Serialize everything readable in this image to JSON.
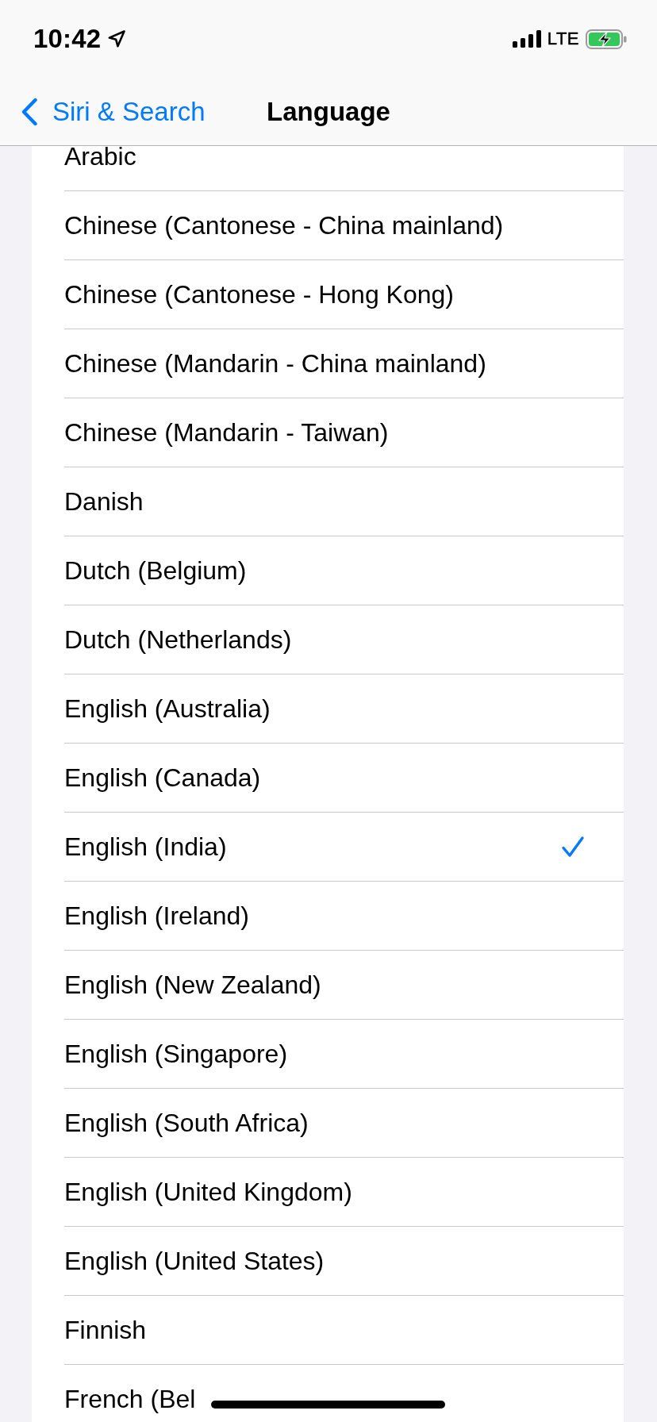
{
  "status_bar": {
    "time": "10:42",
    "network": "LTE"
  },
  "nav_bar": {
    "back_label": "Siri & Search",
    "title": "Language"
  },
  "languages": [
    {
      "name": "Arabic",
      "selected": false
    },
    {
      "name": "Chinese (Cantonese - China mainland)",
      "selected": false
    },
    {
      "name": "Chinese (Cantonese - Hong Kong)",
      "selected": false
    },
    {
      "name": "Chinese (Mandarin - China mainland)",
      "selected": false
    },
    {
      "name": "Chinese (Mandarin - Taiwan)",
      "selected": false
    },
    {
      "name": "Danish",
      "selected": false
    },
    {
      "name": "Dutch (Belgium)",
      "selected": false
    },
    {
      "name": "Dutch (Netherlands)",
      "selected": false
    },
    {
      "name": "English (Australia)",
      "selected": false
    },
    {
      "name": "English (Canada)",
      "selected": false
    },
    {
      "name": "English (India)",
      "selected": true
    },
    {
      "name": "English (Ireland)",
      "selected": false
    },
    {
      "name": "English (New Zealand)",
      "selected": false
    },
    {
      "name": "English (Singapore)",
      "selected": false
    },
    {
      "name": "English (South Africa)",
      "selected": false
    },
    {
      "name": "English (United Kingdom)",
      "selected": false
    },
    {
      "name": "English (United States)",
      "selected": false
    },
    {
      "name": "Finnish",
      "selected": false
    },
    {
      "name": "French (Bel",
      "selected": false
    }
  ]
}
